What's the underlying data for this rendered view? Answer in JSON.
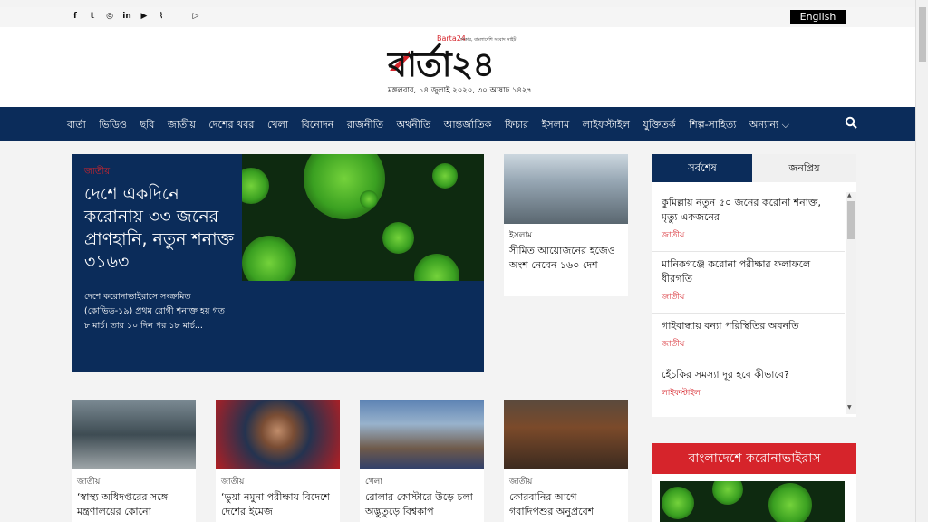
{
  "topbar": {
    "social_icons": [
      "facebook-icon",
      "twitter-icon",
      "instagram-icon",
      "linkedin-icon",
      "youtube-icon",
      "rss-icon",
      "apple-icon",
      "play-store-icon"
    ],
    "social_glyphs": [
      "f",
      "𝕥",
      "◎",
      "in",
      "▶",
      "⌇",
      "",
      "▷"
    ],
    "english_label": "English"
  },
  "header": {
    "logo_text": "বার্তা২৪",
    "logo_small": "Barta24",
    "logo_tagline": "ঢাকার, বাংলাদেশি সংবাদ সাইট",
    "date": "মঙ্গলবার, ১৪ জুলাই ২০২০, ৩০ আষাঢ় ১৪২৭"
  },
  "nav": {
    "items": [
      "বার্তা",
      "ভিডিও",
      "ছবি",
      "জাতীয়",
      "দেশের খবর",
      "খেলা",
      "বিনোদন",
      "রাজনীতি",
      "অর্থনীতি",
      "আন্তর্জাতিক",
      "ফিচার",
      "ইসলাম",
      "লাইফস্টাইল",
      "যুক্তিতর্ক",
      "শিল্প-সাহিত্য",
      "অন্যান্য ⌵"
    ]
  },
  "hero": {
    "category": "জাতীয়",
    "title": "দেশে একদিনে করোনায় ৩৩ জনের প্রাণহানি, নতুন শনাক্ত ৩১৬৩",
    "description": "দেশে করোনাভাইরাসে সংক্রমিত (কোভিড-১৯) প্রথম রোগী শনাক্ত হয় গত ৮ মার্চ। তার ১০ দিন পর ১৮ মার্চ..."
  },
  "side_card": {
    "category": "ইসলাম",
    "title": "সীমিত আয়োজনের হজেও অংশ নেবেন ১৬০ দেশ"
  },
  "tabs": {
    "active": "সর্বশেষ",
    "inactive": "জনপ্রিয়",
    "items": [
      {
        "title": "কুমিল্লায় নতুন ৫০ জনের করোনা শনাক্ত, মৃত্যু একজনের",
        "category": "জাতীয়"
      },
      {
        "title": "মানিকগঞ্জে করোনা পরীক্ষার ফলাফলে ধীরগতি",
        "category": "জাতীয়"
      },
      {
        "title": "গাইবান্ধায় বন্যা পরিস্থিতির অবনতি",
        "category": "জাতীয়"
      },
      {
        "title": "হেঁচকির সমস্যা দূর হবে কীভাবে?",
        "category": "লাইফস্টাইল"
      }
    ]
  },
  "corona_box": {
    "title": "বাংলাদেশে করোনাভাইরাস"
  },
  "grid": [
    {
      "category": "জাতীয়",
      "title": "‘স্বাস্থ্য অধিদপ্তরের সঙ্গে মন্ত্রণালয়ের কোনো"
    },
    {
      "category": "জাতীয়",
      "title": "‘ভুয়া নমুনা পরীক্ষায় বিদেশে দেশের ইমেজ"
    },
    {
      "category": "খেলা",
      "title": "রোলার কোস্টারে উড়ে চলা অদ্ভুতুড়ে বিশ্বকাপ"
    },
    {
      "category": "জাতীয়",
      "title": "কোরবানির আগে গবাদিপশুর অনুপ্রবেশ"
    }
  ],
  "colors": {
    "navy": "#0b2c5a",
    "red": "#d6242b"
  }
}
